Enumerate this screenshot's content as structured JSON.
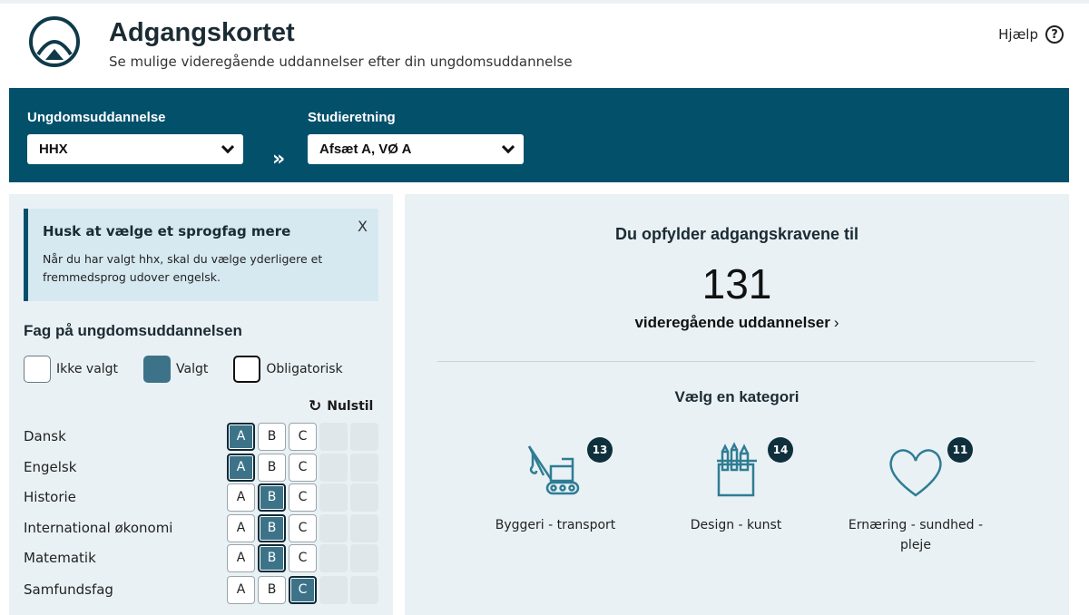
{
  "header": {
    "title": "Adgangskortet",
    "subtitle": "Se mulige videregående uddannelser efter din ungdomsuddannelse",
    "help_label": "Hjælp",
    "help_icon": "question-circle-icon"
  },
  "selectors": {
    "education_label": "Ungdomsuddannelse",
    "education_value": "HHX",
    "direction_label": "Studieretning",
    "direction_value": "Afsæt A, VØ A",
    "arrows": "»"
  },
  "notice": {
    "title": "Husk at vælge et sprogfag mere",
    "text": "Når du har valgt hhx, skal du vælge yderligere et fremmedsprog udover engelsk.",
    "close": "X"
  },
  "subjects": {
    "title": "Fag på ungdomsuddannelsen",
    "legend": {
      "not_selected": "Ikke valgt",
      "selected": "Valgt",
      "mandatory": "Obligatorisk"
    },
    "reset_label": "Nulstil",
    "rows": [
      {
        "name": "Dansk",
        "levels": [
          "A",
          "B",
          "C"
        ],
        "selected": "A"
      },
      {
        "name": "Engelsk",
        "levels": [
          "A",
          "B",
          "C"
        ],
        "selected": "A"
      },
      {
        "name": "Historie",
        "levels": [
          "A",
          "B",
          "C"
        ],
        "selected": "B"
      },
      {
        "name": "International økonomi",
        "levels": [
          "A",
          "B",
          "C"
        ],
        "selected": "B"
      },
      {
        "name": "Matematik",
        "levels": [
          "A",
          "B",
          "C"
        ],
        "selected": "B"
      },
      {
        "name": "Samfundsfag",
        "levels": [
          "A",
          "B",
          "C"
        ],
        "selected": "C"
      }
    ]
  },
  "result": {
    "heading": "Du opfylder adgangskravene til",
    "count": "131",
    "link_label": "videregående uddannelser",
    "link_arrow": "›"
  },
  "categories": {
    "heading": "Vælg en kategori",
    "items": [
      {
        "label": "Byggeri - transport",
        "count": "13",
        "icon": "crane-icon"
      },
      {
        "label": "Design - kunst",
        "count": "14",
        "icon": "pencil-cup-icon"
      },
      {
        "label": "Ernæring - sundhed - pleje",
        "count": "11",
        "icon": "heart-icon"
      }
    ]
  },
  "colors": {
    "brand": "#03506b",
    "selected": "#3d7389",
    "badge": "#0f2f3c",
    "panel": "#e9f1f5"
  }
}
